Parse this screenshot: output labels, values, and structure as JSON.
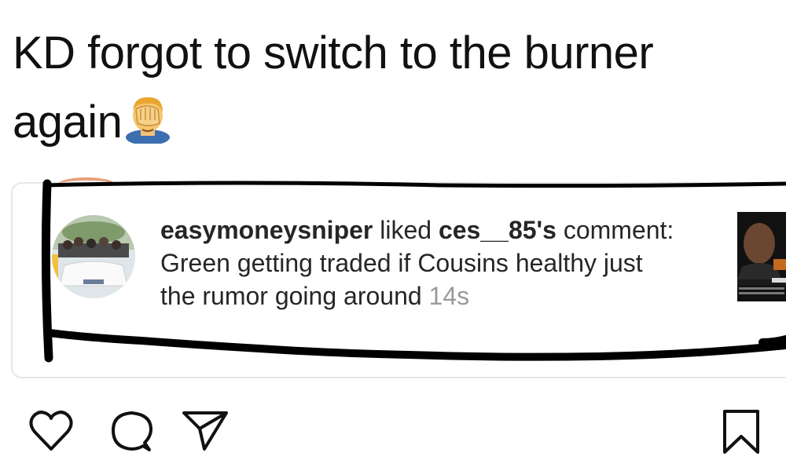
{
  "post": {
    "caption": "KD forgot to switch to the burner again",
    "caption_emoji": "facepalm-emoji"
  },
  "notification": {
    "username": "easymoneysniper",
    "action": "liked",
    "target_user": "ces__85's",
    "comment_label": "comment:",
    "comment_text": "Green getting traded if Cousins healthy just the rumor going around",
    "time": "14s"
  },
  "actions": {
    "like_icon": "heart-icon",
    "comment_icon": "comment-icon",
    "share_icon": "share-icon",
    "save_icon": "bookmark-icon"
  },
  "colors": {
    "text": "#111111",
    "timestamp": "#9a9a9a",
    "marker": "#000000"
  }
}
